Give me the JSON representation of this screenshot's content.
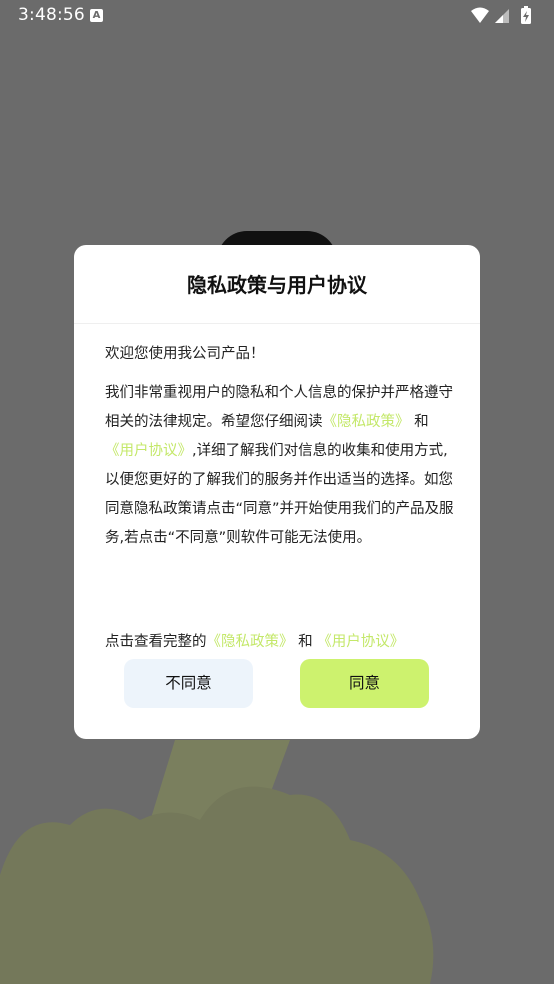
{
  "status_bar": {
    "time": "3:48:56",
    "notification_icon_letter": "A",
    "icons": [
      "wifi-icon",
      "signal-icon",
      "battery-charging-icon"
    ]
  },
  "dialog": {
    "title": "隐私政策与用户协议",
    "welcome": "欢迎您使用我公司产品！",
    "paragraph": {
      "part1": "我们非常重视用户的隐私和个人信息的保护并严格遵守相关的法律规定。希望您仔细阅读",
      "privacy_link": "《隐私政策》",
      "and": "和",
      "terms_link": "《用户协议》",
      "part2": ",详细了解我们对信息的收集和使用方式,以便您更好的了解我们的服务并作出适当的选择。如您同意隐私政策请点击“同意”并开始使用我们的产品及服务,若点击“不同意”则软件可能无法使用。"
    },
    "view_line": {
      "prefix": "点击查看完整的",
      "privacy_link": "《隐私政策》",
      "and": "和",
      "terms_link": "《用户协议》"
    },
    "disagree_label": "不同意",
    "agree_label": "同意"
  },
  "colors": {
    "overlay": "#6b6b6b",
    "link": "#c4e86a",
    "agree_button": "#cdf26e",
    "disagree_button": "#edf4fb"
  }
}
